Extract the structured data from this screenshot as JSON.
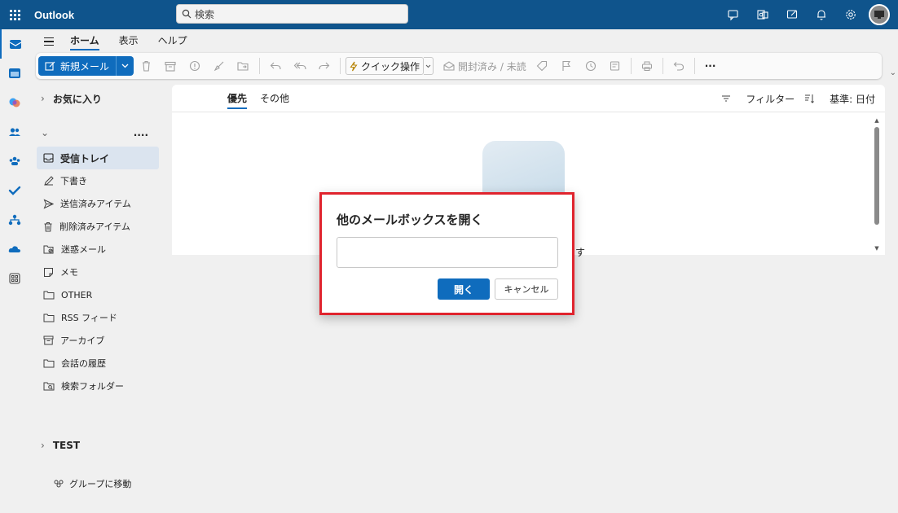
{
  "titlebar": {
    "app_name": "Outlook",
    "search_placeholder": "検索"
  },
  "ribbon": {
    "tabs": [
      "ホーム",
      "表示",
      "ヘルプ"
    ],
    "new_mail": "新規メール",
    "quick_action": "クイック操作",
    "read_unread": "開封済み / 未読",
    "more": "···"
  },
  "folders": {
    "favorites": "お気に入り",
    "account_menu": "....",
    "items": [
      {
        "label": "受信トレイ",
        "icon": "inbox-icon"
      },
      {
        "label": "下書き",
        "icon": "draft-icon"
      },
      {
        "label": "送信済みアイテム",
        "icon": "send-icon"
      },
      {
        "label": "削除済みアイテム",
        "icon": "trash-icon"
      },
      {
        "label": "迷惑メール",
        "icon": "junk-icon"
      },
      {
        "label": "メモ",
        "icon": "note-icon"
      },
      {
        "label": "OTHER",
        "icon": "folder-icon"
      },
      {
        "label": "RSS フィード",
        "icon": "folder-icon"
      },
      {
        "label": "アーカイブ",
        "icon": "archive-icon"
      },
      {
        "label": "会話の履歴",
        "icon": "folder-icon"
      },
      {
        "label": "検索フォルダー",
        "icon": "search-folder-icon"
      }
    ],
    "test_group": "TEST",
    "go_to_groups": "グループに移動"
  },
  "message_list": {
    "tab_focused": "優先",
    "tab_other": "その他",
    "filter": "フィルター",
    "sort": "基準: 日付",
    "partial_text": "す"
  },
  "dialog": {
    "title": "他のメールボックスを開く",
    "input_value": "",
    "open_button": "開く",
    "cancel_button": "キャンセル"
  },
  "colors": {
    "titlebar": "#0f548c",
    "accent": "#0f6cbd",
    "highlight_border": "#e0242e",
    "selected_folder": "#dbe4ef"
  }
}
